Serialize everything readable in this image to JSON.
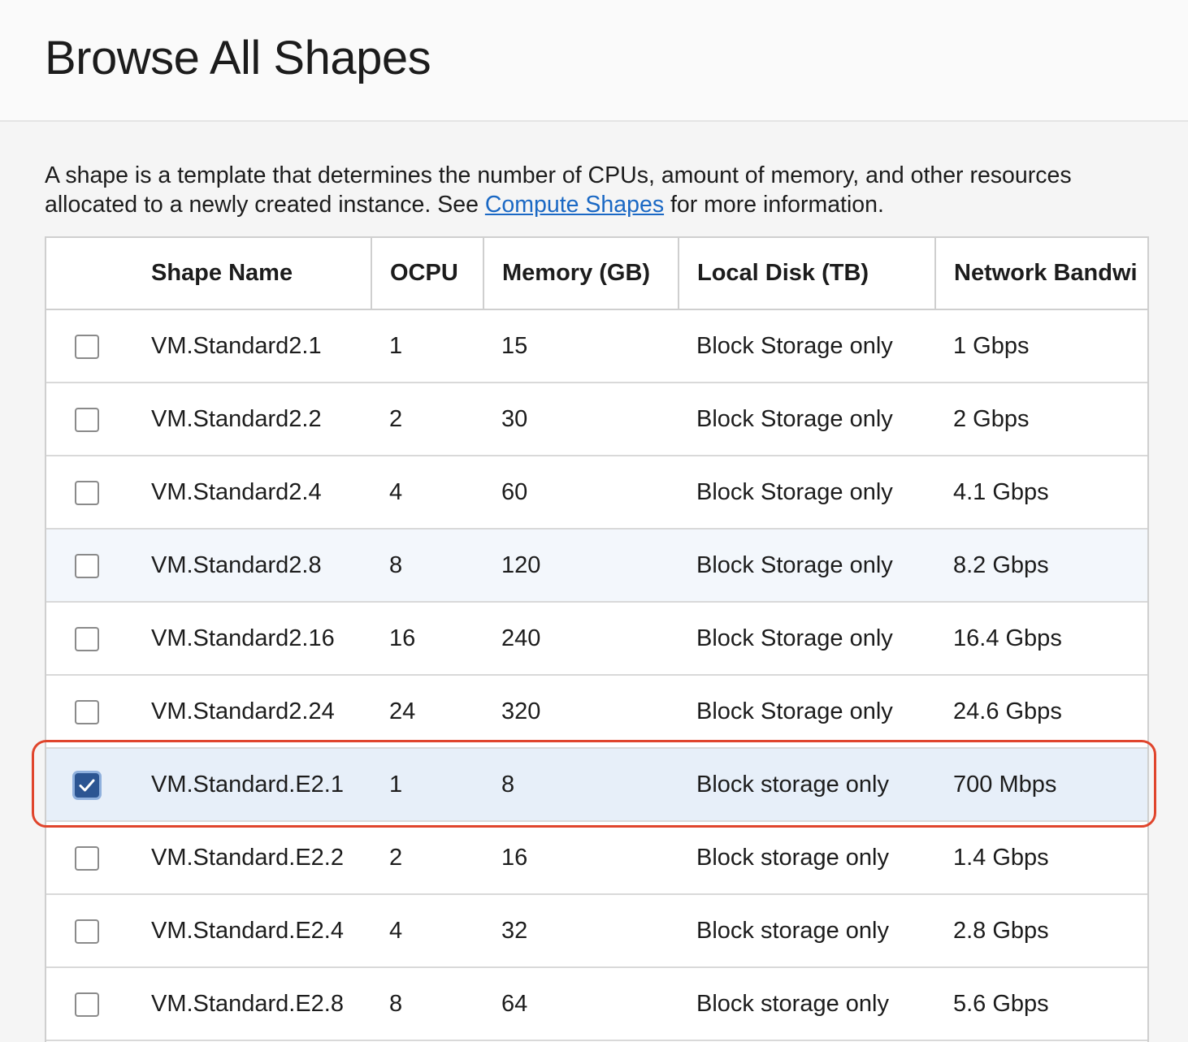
{
  "page": {
    "title": "Browse All Shapes",
    "description_before": "A shape is a template that determines the number of CPUs, amount of memory, and other resources allocated to a newly created instance. See ",
    "description_link": "Compute Shapes",
    "description_after": " for more information."
  },
  "table": {
    "columns": [
      "Shape Name",
      "OCPU",
      "Memory (GB)",
      "Local Disk (TB)",
      "Network Bandwi"
    ],
    "rows": [
      {
        "name": "VM.Standard2.1",
        "ocpu": "1",
        "memory": "15",
        "disk": "Block Storage only",
        "network": "1 Gbps",
        "checked": false,
        "state": "normal"
      },
      {
        "name": "VM.Standard2.2",
        "ocpu": "2",
        "memory": "30",
        "disk": "Block Storage only",
        "network": "2 Gbps",
        "checked": false,
        "state": "normal"
      },
      {
        "name": "VM.Standard2.4",
        "ocpu": "4",
        "memory": "60",
        "disk": "Block Storage only",
        "network": "4.1 Gbps",
        "checked": false,
        "state": "normal"
      },
      {
        "name": "VM.Standard2.8",
        "ocpu": "8",
        "memory": "120",
        "disk": "Block Storage only",
        "network": "8.2 Gbps",
        "checked": false,
        "state": "hover"
      },
      {
        "name": "VM.Standard2.16",
        "ocpu": "16",
        "memory": "240",
        "disk": "Block Storage only",
        "network": "16.4 Gbps",
        "checked": false,
        "state": "normal"
      },
      {
        "name": "VM.Standard2.24",
        "ocpu": "24",
        "memory": "320",
        "disk": "Block Storage only",
        "network": "24.6 Gbps",
        "checked": false,
        "state": "normal"
      },
      {
        "name": "VM.Standard.E2.1",
        "ocpu": "1",
        "memory": "8",
        "disk": "Block storage only",
        "network": "700 Mbps",
        "checked": true,
        "state": "selected"
      },
      {
        "name": "VM.Standard.E2.2",
        "ocpu": "2",
        "memory": "16",
        "disk": "Block storage only",
        "network": "1.4 Gbps",
        "checked": false,
        "state": "normal"
      },
      {
        "name": "VM.Standard.E2.4",
        "ocpu": "4",
        "memory": "32",
        "disk": "Block storage only",
        "network": "2.8 Gbps",
        "checked": false,
        "state": "normal"
      },
      {
        "name": "VM.Standard.E2.8",
        "ocpu": "8",
        "memory": "64",
        "disk": "Block storage only",
        "network": "5.6 Gbps",
        "checked": false,
        "state": "normal"
      }
    ]
  },
  "icons": {
    "checkbox_check": "check-icon"
  },
  "colors": {
    "link": "#1a68c4",
    "checkbox_checked": "#2c5592",
    "selected_row": "#e7eff9",
    "highlight_outline": "#e0452c"
  }
}
